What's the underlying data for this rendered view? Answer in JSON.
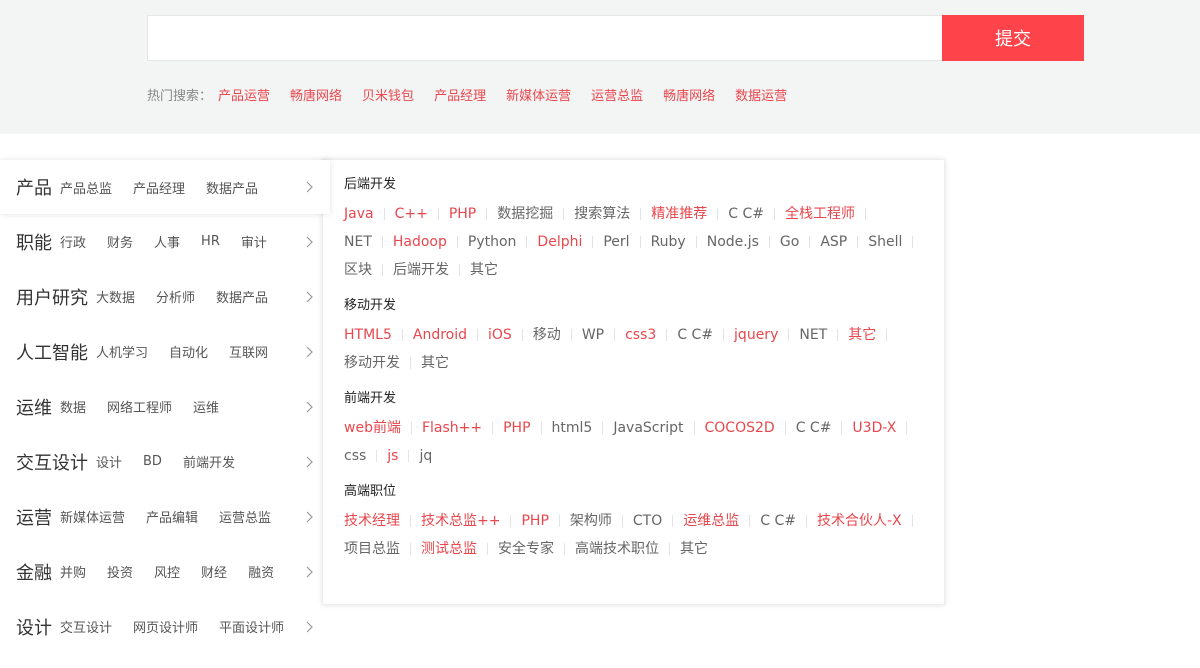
{
  "search": {
    "placeholder": "",
    "value": "",
    "submit_label": "提交",
    "hot_label": "热门搜索：",
    "hot_terms": [
      "产品运营",
      "畅唐网络",
      "贝米钱包",
      "产品经理",
      "新媒体运营",
      "运营总监",
      "畅唐网络",
      "数据运营"
    ]
  },
  "colors": {
    "accent": "#ff434a",
    "link_red": "#e8474d",
    "gray_text": "#666666",
    "top_bg": "#f3f4f4"
  },
  "categories": [
    {
      "title": "产品",
      "subs": [
        "产品总监",
        "产品经理",
        "数据产品"
      ],
      "active": true,
      "icon": "chevron-right-icon"
    },
    {
      "title": "职能",
      "subs": [
        "行政",
        "财务",
        "人事",
        "HR",
        "审计"
      ],
      "icon": "chevron-right-icon"
    },
    {
      "title": "用户研究",
      "subs": [
        "大数据",
        "分析师",
        "数据产品"
      ],
      "icon": "chevron-right-icon"
    },
    {
      "title": "人工智能",
      "subs": [
        "人机学习",
        "自动化",
        "互联网"
      ],
      "icon": "chevron-right-icon"
    },
    {
      "title": "运维",
      "subs": [
        "数据",
        "网络工程师",
        "运维"
      ],
      "icon": "chevron-right-icon"
    },
    {
      "title": "交互设计",
      "subs": [
        "设计",
        "BD",
        "前端开发"
      ],
      "icon": "chevron-right-icon"
    },
    {
      "title": "运营",
      "subs": [
        "新媒体运营",
        "产品编辑",
        "运营总监"
      ],
      "icon": "chevron-right-icon"
    },
    {
      "title": "金融",
      "subs": [
        "并购",
        "投资",
        "风控",
        "财经",
        "融资"
      ],
      "icon": "chevron-right-icon"
    },
    {
      "title": "设计",
      "subs": [
        "交互设计",
        "网页设计师",
        "平面设计师"
      ],
      "icon": "chevron-right-icon"
    }
  ],
  "panel": {
    "groups": [
      {
        "title": "后端开发",
        "tags": [
          {
            "label": "Java",
            "hl": true
          },
          {
            "label": "C++",
            "hl": true
          },
          {
            "label": "PHP",
            "hl": true
          },
          {
            "label": "数据挖掘",
            "hl": false
          },
          {
            "label": "搜索算法",
            "hl": false
          },
          {
            "label": "精准推荐",
            "hl": true
          },
          {
            "label": "C C#",
            "hl": false
          },
          {
            "label": "全栈工程师",
            "hl": true
          },
          {
            "label": "NET",
            "hl": false
          },
          {
            "label": "Hadoop",
            "hl": true
          },
          {
            "label": "Python",
            "hl": false
          },
          {
            "label": "Delphi",
            "hl": true
          },
          {
            "label": "Perl",
            "hl": false
          },
          {
            "label": "Ruby",
            "hl": false
          },
          {
            "label": "Node.js",
            "hl": false
          },
          {
            "label": "Go",
            "hl": false
          },
          {
            "label": "ASP",
            "hl": false
          },
          {
            "label": "Shell",
            "hl": false
          },
          {
            "label": "区块",
            "hl": false
          },
          {
            "label": "后端开发",
            "hl": false
          },
          {
            "label": "其它",
            "hl": false
          }
        ]
      },
      {
        "title": "移动开发",
        "tags": [
          {
            "label": "HTML5",
            "hl": true
          },
          {
            "label": "Android",
            "hl": true
          },
          {
            "label": "iOS",
            "hl": true
          },
          {
            "label": "移动",
            "hl": false
          },
          {
            "label": "WP",
            "hl": false
          },
          {
            "label": "css3",
            "hl": true
          },
          {
            "label": "C C#",
            "hl": false
          },
          {
            "label": "jquery",
            "hl": true
          },
          {
            "label": "NET",
            "hl": false
          },
          {
            "label": "其它",
            "hl": true
          },
          {
            "label": "移动开发",
            "hl": false
          },
          {
            "label": "其它",
            "hl": false
          }
        ]
      },
      {
        "title": "前端开发",
        "tags": [
          {
            "label": "web前端",
            "hl": true
          },
          {
            "label": "Flash++",
            "hl": true
          },
          {
            "label": "PHP",
            "hl": true
          },
          {
            "label": "html5",
            "hl": false
          },
          {
            "label": "JavaScript",
            "hl": false
          },
          {
            "label": "COCOS2D",
            "hl": true
          },
          {
            "label": "C C#",
            "hl": false
          },
          {
            "label": "U3D-X",
            "hl": true
          },
          {
            "label": "css",
            "hl": false
          },
          {
            "label": "js",
            "hl": true
          },
          {
            "label": "jq",
            "hl": false
          }
        ]
      },
      {
        "title": "高端职位",
        "tags": [
          {
            "label": "技术经理",
            "hl": true
          },
          {
            "label": "技术总监++",
            "hl": true
          },
          {
            "label": "PHP",
            "hl": true
          },
          {
            "label": "架构师",
            "hl": false
          },
          {
            "label": "CTO",
            "hl": false
          },
          {
            "label": "运维总监",
            "hl": true
          },
          {
            "label": "C C#",
            "hl": false
          },
          {
            "label": "技术合伙人-X",
            "hl": true
          },
          {
            "label": "项目总监",
            "hl": false
          },
          {
            "label": "测试总监",
            "hl": true
          },
          {
            "label": "安全专家",
            "hl": false
          },
          {
            "label": "高端技术职位",
            "hl": false
          },
          {
            "label": "其它",
            "hl": false
          }
        ]
      }
    ]
  }
}
